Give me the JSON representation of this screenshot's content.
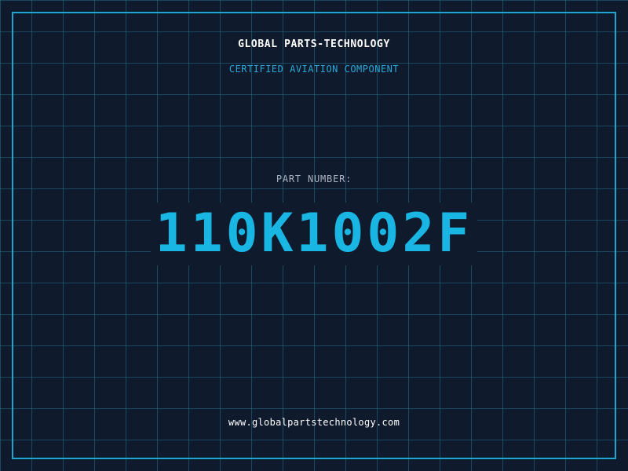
{
  "header": {
    "company": "GLOBAL PARTS-TECHNOLOGY",
    "subtitle": "CERTIFIED AVIATION COMPONENT"
  },
  "part": {
    "label": "PART NUMBER:",
    "number": "110K1002F"
  },
  "footer": {
    "website": "www.globalpartstechnology.com"
  },
  "colors": {
    "background": "#101a2d",
    "grid": "#2896b4",
    "accent": "#1fa6cf",
    "part_number": "#19b6e3",
    "heading": "#ffffff",
    "label": "#aab4c2"
  }
}
